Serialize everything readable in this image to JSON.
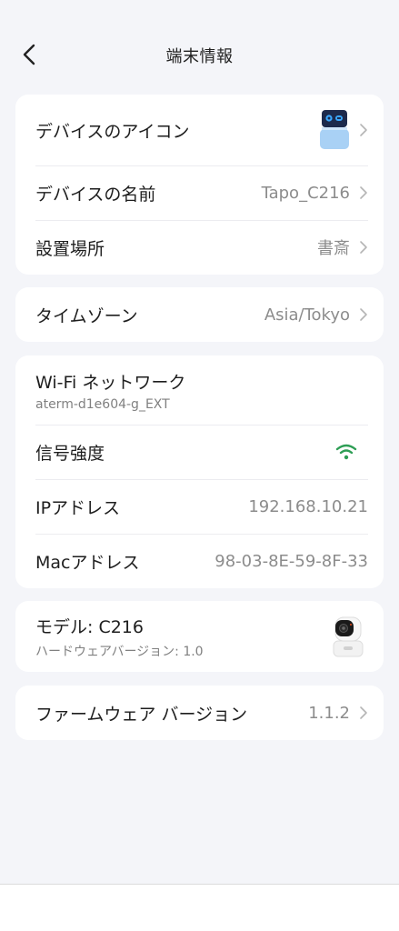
{
  "header": {
    "title": "端末情報",
    "back_icon": "chevron-left-icon"
  },
  "device": {
    "icon_label": "デバイスのアイコン",
    "name_label": "デバイスの名前",
    "name_value": "Tapo_C216",
    "location_label": "設置場所",
    "location_value": "書斎"
  },
  "timezone": {
    "label": "タイムゾーン",
    "value": "Asia/Tokyo"
  },
  "network": {
    "wifi_label": "Wi-Fi ネットワーク",
    "wifi_ssid": "aterm-d1e604-g_EXT",
    "signal_label": "信号強度",
    "signal_icon": "wifi-signal-icon",
    "signal_color": "#2e9e55",
    "ip_label": "IPアドレス",
    "ip_value": "192.168.10.21",
    "mac_label": "Macアドレス",
    "mac_value": "98-03-8E-59-8F-33"
  },
  "model": {
    "label": "モデル: C216",
    "hardware_version": "ハードウェアバージョン: 1.0",
    "image_icon": "camera-product-icon"
  },
  "firmware": {
    "label": "ファームウェア バージョン",
    "value": "1.1.2"
  }
}
